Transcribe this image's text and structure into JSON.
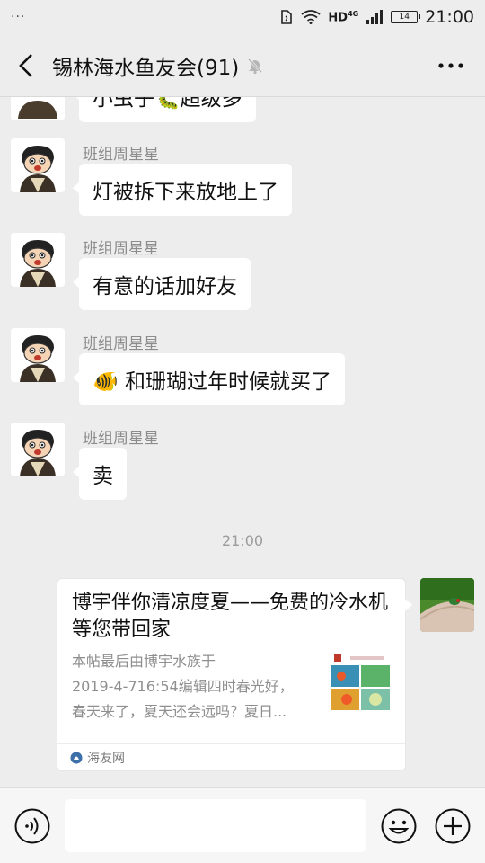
{
  "status_bar": {
    "left_dots": "···",
    "network": "HD",
    "network_sup": "4G",
    "battery": "14",
    "time": "21:00"
  },
  "header": {
    "title": "锡林海水鱼友会(91)",
    "back_icon": "chevron-left-icon",
    "mute_icon": "bell-muted-icon",
    "more_icon": "more-dots-icon"
  },
  "messages": [
    {
      "sender": "",
      "text": "小虫子🐛超级多"
    },
    {
      "sender": "班组周星星",
      "text": "灯被拆下来放地上了"
    },
    {
      "sender": "班组周星星",
      "text": "有意的话加好友"
    },
    {
      "sender": "班组周星星",
      "text": "🐠 和珊瑚过年时候就买了"
    },
    {
      "sender": "班组周星星",
      "text": "卖"
    }
  ],
  "time_divider": "21:00",
  "link_card": {
    "title": "博宇伴你清凉度夏——免费的冷水机等您带回家",
    "desc_line1": "本帖最后由博宇水族于",
    "desc_line2": "2019-4-716:54编辑四时春光好，",
    "desc_line3": "春天来了，夏天还会远吗？夏日...",
    "source": "海友网",
    "thumb_icon": "article-thumbnail-icon",
    "source_icon": "haiyou-logo-icon"
  },
  "input_bar": {
    "placeholder": "",
    "voice_icon": "voice-icon",
    "emoji_icon": "emoji-icon",
    "plus_icon": "plus-icon"
  }
}
